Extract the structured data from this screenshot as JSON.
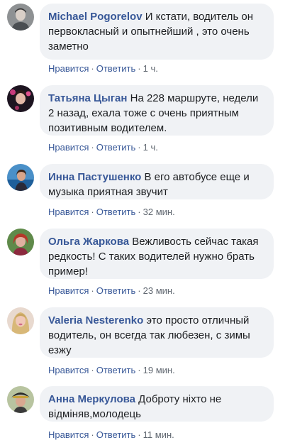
{
  "comments": [
    {
      "author": "Michael Pogorelov",
      "text": "И кстати, водитель он первокласный и опытнейший , это очень заметно",
      "like": "Нравится",
      "reply": "Ответить",
      "time": "1 ч.",
      "avatar_icon": "avatar-man-gray"
    },
    {
      "author": "Татьяна Цыган",
      "text": "На 228 маршруте, недели 2 назад, ехала тоже с очень приятным позитивным водителем.",
      "like": "Нравится",
      "reply": "Ответить",
      "time": "1 ч.",
      "avatar_icon": "avatar-woman-dark"
    },
    {
      "author": "Инна Пастушенко",
      "text": "В его автобусе еще и музыка приятная звучит",
      "like": "Нравится",
      "reply": "Ответить",
      "time": "32 мин.",
      "avatar_icon": "avatar-woman-blue"
    },
    {
      "author": "Ольга Жаркова",
      "text": "Вежливость сейчас такая редкость! С таких водителей нужно брать пример!",
      "like": "Нравится",
      "reply": "Ответить",
      "time": "23 мин.",
      "avatar_icon": "avatar-woman-red"
    },
    {
      "author": "Valeria Nesterenko",
      "text": "это просто отличный водитель, он всегда так любезен, с зимы езжу",
      "like": "Нравится",
      "reply": "Ответить",
      "time": "19 мин.",
      "avatar_icon": "avatar-woman-blonde"
    },
    {
      "author": "Анна Меркулова",
      "text": "Доброту ніхто не відміняв,молодець",
      "like": "Нравится",
      "reply": "Ответить",
      "time": "11 мин.",
      "avatar_icon": "avatar-woman-hat"
    }
  ],
  "colors": {
    "bubble": "#f0f2f5",
    "link": "#385898",
    "meta": "#606770",
    "text": "#1c1e21"
  }
}
